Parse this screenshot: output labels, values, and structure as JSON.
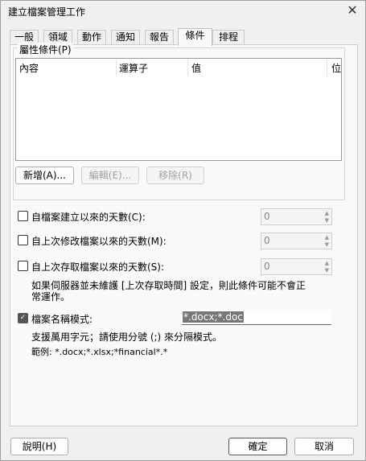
{
  "dialog": {
    "title": "建立檔案管理工作"
  },
  "tabs": [
    {
      "label": "一般"
    },
    {
      "label": "領域"
    },
    {
      "label": "動作"
    },
    {
      "label": "通知"
    },
    {
      "label": "報告"
    },
    {
      "label": "條件"
    },
    {
      "label": "排程"
    }
  ],
  "property_group": {
    "label": "屬性條件(P)",
    "columns": [
      "內容",
      "運算子",
      "值",
      "位"
    ],
    "add_button": "新增(A)...",
    "edit_button": "編輯(E)...",
    "delete_button": "移除(R)"
  },
  "conditions": [
    {
      "label": "自檔案建立以來的天數(C):",
      "value": "0",
      "checked": false
    },
    {
      "label": "自上次修改檔案以來的天數(M):",
      "value": "0",
      "checked": false
    },
    {
      "label": "自上次存取檔案以來的天數(S):",
      "value": "0",
      "checked": false
    }
  ],
  "access_note": "如果伺服器並未維護 [上次存取時間] 設定，則此條件可能不會正常運作。",
  "filename_pattern": {
    "label": "檔案名稱模式:",
    "value": "*.docx;*.doc",
    "checked": true,
    "hint": "支援萬用字元；請使用分號 (;) 來分隔模式。",
    "example": "範例: *.docx;*.xlsx;*financial*.*"
  },
  "footer": {
    "help_button": "說明(H)",
    "ok_button": "確定",
    "cancel_button": "取消"
  }
}
